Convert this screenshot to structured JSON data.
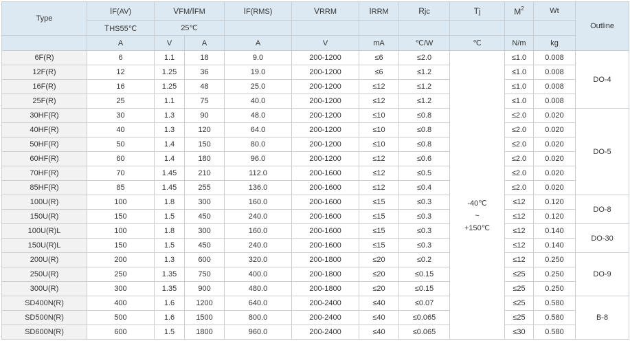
{
  "header": {
    "type": "Type",
    "outline": "Outline",
    "if_av": {
      "main": "I",
      "sub": "F(AV)"
    },
    "vfm_ifm": {
      "v": "V",
      "v_sub": "FM",
      "slash": "/",
      "i": "I",
      "i_sub": "FM"
    },
    "if_rms": {
      "main": "I",
      "sub": "F(RMS)"
    },
    "vrrm": {
      "main": "V",
      "sub": "RRM"
    },
    "irrm": {
      "main": "I",
      "sub": "RRM"
    },
    "rjc": {
      "main": "R",
      "sub": "jc"
    },
    "tj": {
      "main": "T",
      "sub": "j"
    },
    "m2": {
      "main": "M",
      "sup": "2"
    },
    "wt": "Wt",
    "condition_ths": {
      "main": "T",
      "sub": "HS",
      "value": "55℃"
    },
    "condition_25": "25℃",
    "units": {
      "if_av": "A",
      "vfm": "V",
      "ifm": "A",
      "if_rms": "A",
      "vrrm": "V",
      "irrm": "mA",
      "rjc": "℃/W",
      "tj": "℃",
      "m2": "N/m",
      "wt": "kg"
    }
  },
  "tj_range": {
    "low": "-40℃",
    "tilde": "~",
    "high": "+150℃"
  },
  "rows": [
    {
      "type": "6F(R)",
      "if_av": "6",
      "vfm": "1.1",
      "ifm": "18",
      "if_rms": "9.0",
      "vrrm": "200-1200",
      "irrm": "≤6",
      "rjc": "≤2.0",
      "m2": "≤1.0",
      "wt": "0.008"
    },
    {
      "type": "12F(R)",
      "if_av": "12",
      "vfm": "1.25",
      "ifm": "36",
      "if_rms": "19.0",
      "vrrm": "200-1200",
      "irrm": "≤6",
      "rjc": "≤1.2",
      "m2": "≤1.0",
      "wt": "0.008"
    },
    {
      "type": "16F(R)",
      "if_av": "16",
      "vfm": "1.25",
      "ifm": "48",
      "if_rms": "25.0",
      "vrrm": "200-1200",
      "irrm": "≤12",
      "rjc": "≤1.2",
      "m2": "≤1.0",
      "wt": "0.008"
    },
    {
      "type": "25F(R)",
      "if_av": "25",
      "vfm": "1.1",
      "ifm": "75",
      "if_rms": "40.0",
      "vrrm": "200-1200",
      "irrm": "≤12",
      "rjc": "≤1.2",
      "m2": "≤1.0",
      "wt": "0.008"
    },
    {
      "type": "30HF(R)",
      "if_av": "30",
      "vfm": "1.3",
      "ifm": "90",
      "if_rms": "48.0",
      "vrrm": "200-1200",
      "irrm": "≤10",
      "rjc": "≤0.8",
      "m2": "≤2.0",
      "wt": "0.020"
    },
    {
      "type": "40HF(R)",
      "if_av": "40",
      "vfm": "1.3",
      "ifm": "120",
      "if_rms": "64.0",
      "vrrm": "200-1200",
      "irrm": "≤10",
      "rjc": "≤0.8",
      "m2": "≤2.0",
      "wt": "0.020"
    },
    {
      "type": "50HF(R)",
      "if_av": "50",
      "vfm": "1.4",
      "ifm": "150",
      "if_rms": "80.0",
      "vrrm": "200-1200",
      "irrm": "≤10",
      "rjc": "≤0.8",
      "m2": "≤2.0",
      "wt": "0.020"
    },
    {
      "type": "60HF(R)",
      "if_av": "60",
      "vfm": "1.4",
      "ifm": "180",
      "if_rms": "96.0",
      "vrrm": "200-1200",
      "irrm": "≤12",
      "rjc": "≤0.6",
      "m2": "≤2.0",
      "wt": "0.020"
    },
    {
      "type": "70HF(R)",
      "if_av": "70",
      "vfm": "1.45",
      "ifm": "210",
      "if_rms": "112.0",
      "vrrm": "200-1600",
      "irrm": "≤12",
      "rjc": "≤0.5",
      "m2": "≤2.0",
      "wt": "0.020"
    },
    {
      "type": "85HF(R)",
      "if_av": "85",
      "vfm": "1.45",
      "ifm": "255",
      "if_rms": "136.0",
      "vrrm": "200-1600",
      "irrm": "≤12",
      "rjc": "≤0.4",
      "m2": "≤2.0",
      "wt": "0.020"
    },
    {
      "type": "100U(R)",
      "if_av": "100",
      "vfm": "1.8",
      "ifm": "300",
      "if_rms": "160.0",
      "vrrm": "200-1600",
      "irrm": "≤15",
      "rjc": "≤0.3",
      "m2": "≤12",
      "wt": "0.120"
    },
    {
      "type": "150U(R)",
      "if_av": "150",
      "vfm": "1.5",
      "ifm": "450",
      "if_rms": "240.0",
      "vrrm": "200-1600",
      "irrm": "≤15",
      "rjc": "≤0.3",
      "m2": "≤12",
      "wt": "0.120"
    },
    {
      "type": "100U(R)L",
      "if_av": "100",
      "vfm": "1.8",
      "ifm": "300",
      "if_rms": "160.0",
      "vrrm": "200-1600",
      "irrm": "≤15",
      "rjc": "≤0.3",
      "m2": "≤12",
      "wt": "0.140"
    },
    {
      "type": "150U(R)L",
      "if_av": "150",
      "vfm": "1.5",
      "ifm": "450",
      "if_rms": "240.0",
      "vrrm": "200-1600",
      "irrm": "≤15",
      "rjc": "≤0.3",
      "m2": "≤12",
      "wt": "0.140"
    },
    {
      "type": "200U(R)",
      "if_av": "200",
      "vfm": "1.3",
      "ifm": "600",
      "if_rms": "320.0",
      "vrrm": "200-1800",
      "irrm": "≤20",
      "rjc": "≤0.2",
      "m2": "≤12",
      "wt": "0.250"
    },
    {
      "type": "250U(R)",
      "if_av": "250",
      "vfm": "1.35",
      "ifm": "750",
      "if_rms": "400.0",
      "vrrm": "200-1800",
      "irrm": "≤20",
      "rjc": "≤0.15",
      "m2": "≤25",
      "wt": "0.250"
    },
    {
      "type": "300U(R)",
      "if_av": "300",
      "vfm": "1.35",
      "ifm": "900",
      "if_rms": "480.0",
      "vrrm": "200-1800",
      "irrm": "≤20",
      "rjc": "≤0.15",
      "m2": "≤25",
      "wt": "0.250"
    },
    {
      "type": "SD400N(R)",
      "if_av": "400",
      "vfm": "1.6",
      "ifm": "1200",
      "if_rms": "640.0",
      "vrrm": "200-2400",
      "irrm": "≤40",
      "rjc": "≤0.07",
      "m2": "≤25",
      "wt": "0.580"
    },
    {
      "type": "SD500N(R)",
      "if_av": "500",
      "vfm": "1.6",
      "ifm": "1500",
      "if_rms": "800.0",
      "vrrm": "200-2400",
      "irrm": "≤40",
      "rjc": "≤0.065",
      "m2": "≤25",
      "wt": "0.580"
    },
    {
      "type": "SD600N(R)",
      "if_av": "600",
      "vfm": "1.5",
      "ifm": "1800",
      "if_rms": "960.0",
      "vrrm": "200-2400",
      "irrm": "≤40",
      "rjc": "≤0.065",
      "m2": "≤30",
      "wt": "0.580"
    }
  ],
  "outlines": [
    {
      "label": "DO-4",
      "rows": 4
    },
    {
      "label": "DO-5",
      "rows": 6
    },
    {
      "label": "DO-8",
      "rows": 2
    },
    {
      "label": "DO-30",
      "rows": 2
    },
    {
      "label": "DO-9",
      "rows": 3
    },
    {
      "label": "B-8",
      "rows": 3
    }
  ],
  "colors": {
    "header_bg": "#dce9f2",
    "type_bg": "#f2f2f2",
    "border": "#c8cdd2",
    "text": "#333333"
  }
}
